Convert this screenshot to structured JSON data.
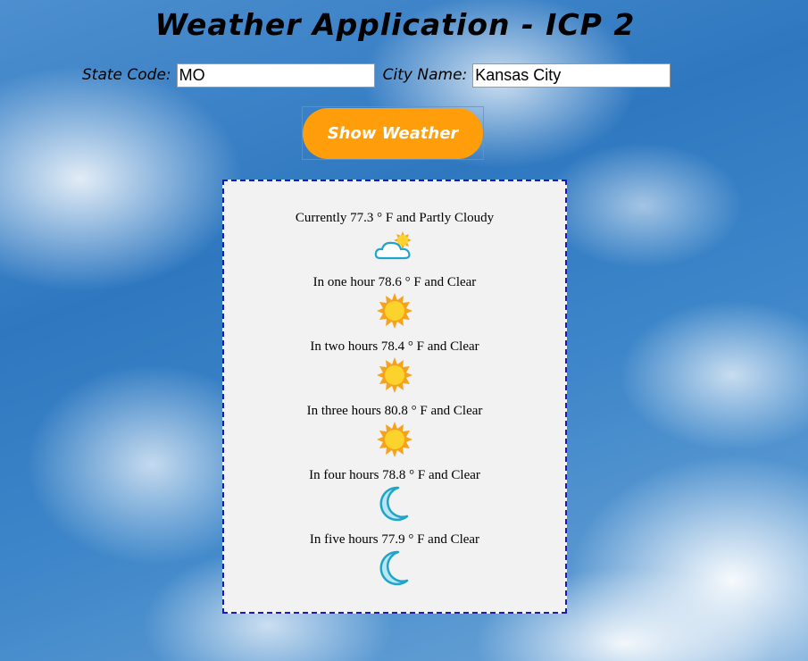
{
  "header": {
    "title": "Weather Application - ICP 2"
  },
  "form": {
    "state_label": "State Code:",
    "state_value": "MO",
    "city_label": "City Name:",
    "city_value": "Kansas City",
    "submit_label": "Show Weather"
  },
  "forecast": [
    {
      "text": "Currently 77.3 ° F and Partly Cloudy",
      "icon": "partly-cloudy-icon"
    },
    {
      "text": "In one hour 78.6 ° F and Clear",
      "icon": "sun-icon"
    },
    {
      "text": "In two hours 78.4 ° F and Clear",
      "icon": "sun-icon"
    },
    {
      "text": "In three hours 80.8 ° F and Clear",
      "icon": "sun-icon"
    },
    {
      "text": "In four hours 78.8 ° F and Clear",
      "icon": "moon-icon"
    },
    {
      "text": "In five hours 77.9 ° F and Clear",
      "icon": "moon-icon"
    }
  ],
  "colors": {
    "button": "#ff9e0a",
    "panel_border": "#1a1ab8",
    "panel_bg": "#f2f2f2"
  }
}
